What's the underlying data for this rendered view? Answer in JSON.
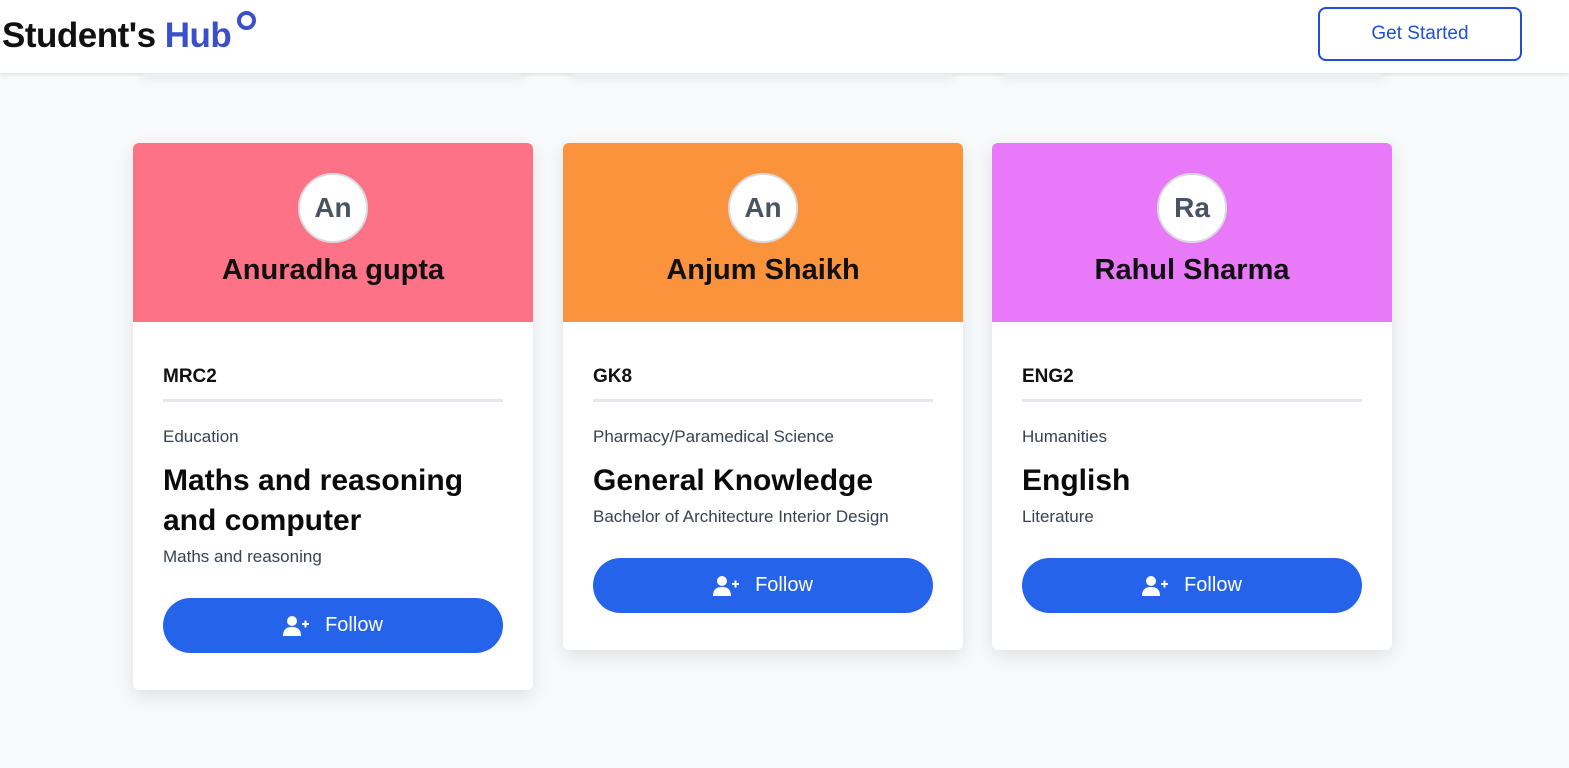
{
  "header": {
    "logo_part1": "Student's",
    "logo_part2": "Hub",
    "cta_label": "Get Started"
  },
  "colors": {
    "accent": "#2563eb",
    "logo_blue": "#3a4fc9",
    "card1_head": "#fe7287",
    "card2_head": "#fb923c",
    "card3_head": "#e879f9"
  },
  "cards": [
    {
      "initials": "An",
      "name": "Anuradha gupta",
      "code": "MRC2",
      "category": "Education",
      "subject": "Maths and reasoning and computer",
      "description": "Maths and reasoning",
      "follow_label": "Follow",
      "follow_icon": "user-plus-icon"
    },
    {
      "initials": "An",
      "name": "Anjum Shaikh",
      "code": "GK8",
      "category": "Pharmacy/Paramedical Science",
      "subject": "General Knowledge",
      "description": "Bachelor of Architecture Interior Design",
      "follow_label": "Follow",
      "follow_icon": "user-plus-icon"
    },
    {
      "initials": "Ra",
      "name": "Rahul Sharma",
      "code": "ENG2",
      "category": "Humanities",
      "subject": "English",
      "description": "Literature",
      "follow_label": "Follow",
      "follow_icon": "user-plus-icon"
    }
  ]
}
